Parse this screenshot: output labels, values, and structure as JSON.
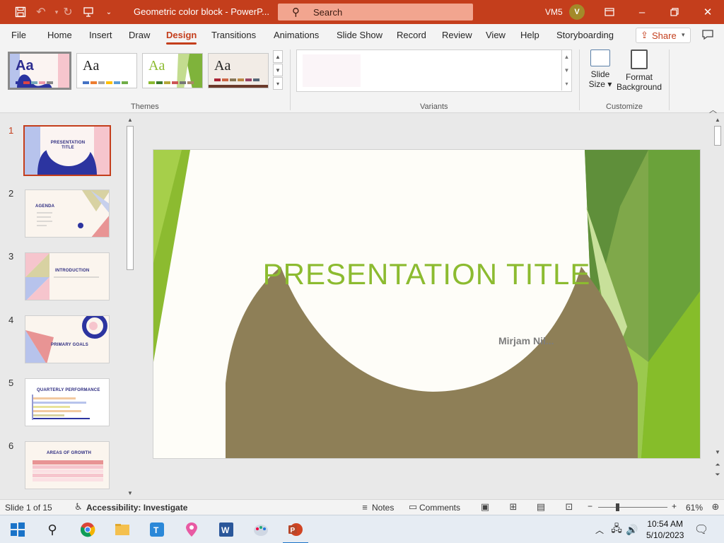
{
  "window": {
    "title": "Geometric color block  -  PowerP...",
    "search_placeholder": "Search",
    "user_initials": "VM5",
    "avatar_letter": "V"
  },
  "menu": {
    "tabs": [
      "File",
      "Home",
      "Insert",
      "Draw",
      "Design",
      "Transitions",
      "Animations",
      "Slide Show",
      "Record",
      "Review",
      "View",
      "Help",
      "Storyboarding"
    ],
    "active_tab": "Design",
    "share_label": "Share"
  },
  "ribbon": {
    "themes_label": "Themes",
    "variants_label": "Variants",
    "customize_label": "Customize",
    "theme_sample_text": "Aa",
    "slide_size_label": "Slide Size",
    "slide_size_line1": "Slide",
    "slide_size_line2": "Size",
    "format_bg_line1": "Format",
    "format_bg_line2": "Background"
  },
  "slides": {
    "thumb_titles": [
      "PRESENTATION TITLE",
      "AGENDA",
      "INTRODUCTION",
      "PRIMARY GOALS",
      "QUARTERLY PERFORMANCE",
      "AREAS OF GROWTH"
    ],
    "numbers": [
      "1",
      "2",
      "3",
      "4",
      "5",
      "6"
    ],
    "active_index": 1
  },
  "main_slide": {
    "title": "PRESENTATION TITLE",
    "subtitle": "Mirjam Nil..."
  },
  "status": {
    "slide_counter": "Slide 1 of 15",
    "accessibility": "Accessibility: Investigate",
    "notes_label": "Notes",
    "comments_label": "Comments",
    "zoom": "61%"
  },
  "taskbar": {
    "time": "10:54 AM",
    "date": "5/10/2023"
  },
  "colors": {
    "accent": "#c43e1c",
    "title_green": "#8cbb30",
    "olive": "#8e7f57"
  }
}
